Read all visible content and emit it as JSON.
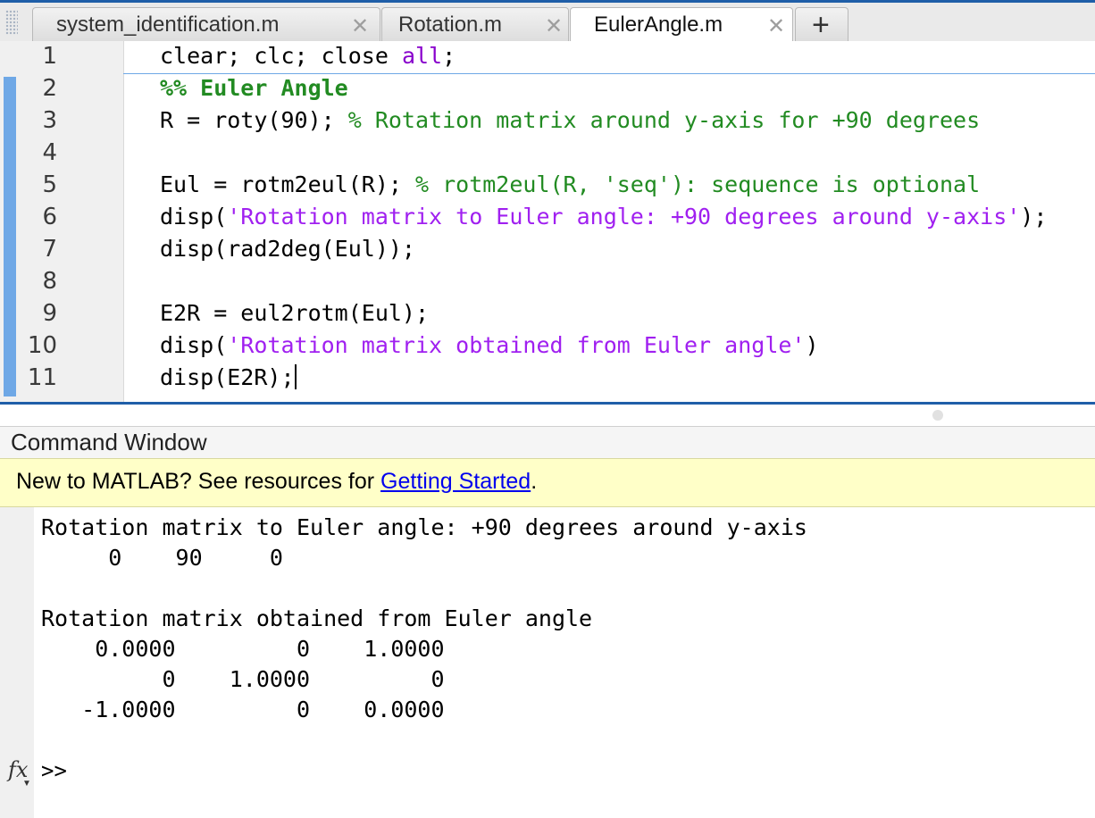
{
  "tabs": [
    {
      "label": "system_identification.m",
      "close_icon": "close-icon"
    },
    {
      "label": "Rotation.m",
      "close_icon": "close-icon"
    },
    {
      "label": "EulerAngle.m",
      "close_icon": "close-icon",
      "active": true
    }
  ],
  "add_tab_label": "+",
  "line_numbers": [
    "1",
    "2",
    "3",
    "4",
    "5",
    "6",
    "7",
    "8",
    "9",
    "10",
    "11"
  ],
  "code": {
    "l1": {
      "a": "clear; clc; close ",
      "kw": "all",
      "b": ";"
    },
    "l2": {
      "section": "%% Euler Angle"
    },
    "l3": {
      "a": "R = roty(90); ",
      "comment": "% Rotation matrix around y-axis for +90 degrees"
    },
    "l5": {
      "a": "Eul = rotm2eul(R); ",
      "comment": "% rotm2eul(R, 'seq'): sequence is optional"
    },
    "l6": {
      "a": "disp(",
      "str": "'Rotation matrix to Euler angle: +90 degrees around y-axis'",
      "b": ");"
    },
    "l7": {
      "a": "disp(rad2deg(Eul));"
    },
    "l9": {
      "a": "E2R = eul2rotm(Eul);"
    },
    "l10": {
      "a": "disp(",
      "str": "'Rotation matrix obtained from Euler angle'",
      "b": ")"
    },
    "l11": {
      "a": "disp(E2R);"
    }
  },
  "command_window": {
    "title": "Command Window",
    "banner_text": "New to MATLAB? See resources for ",
    "banner_link": "Getting Started",
    "banner_end": ".",
    "output": {
      "o1": "Rotation matrix to Euler angle: +90 degrees around y-axis",
      "o2": "     0    90     0",
      "o4": "Rotation matrix obtained from Euler angle",
      "o5": "    0.0000         0    1.0000",
      "o6": "         0    1.0000         0",
      "o7": "   -1.0000         0    0.0000"
    },
    "fx_label": "fx",
    "prompt": ">>"
  },
  "colors": {
    "keyword": "#8800cc",
    "string": "#a020f0",
    "comment": "#228b22",
    "banner_bg": "#ffffc8",
    "accent": "#1f5ea8",
    "change_bar": "#6fa8e6"
  }
}
